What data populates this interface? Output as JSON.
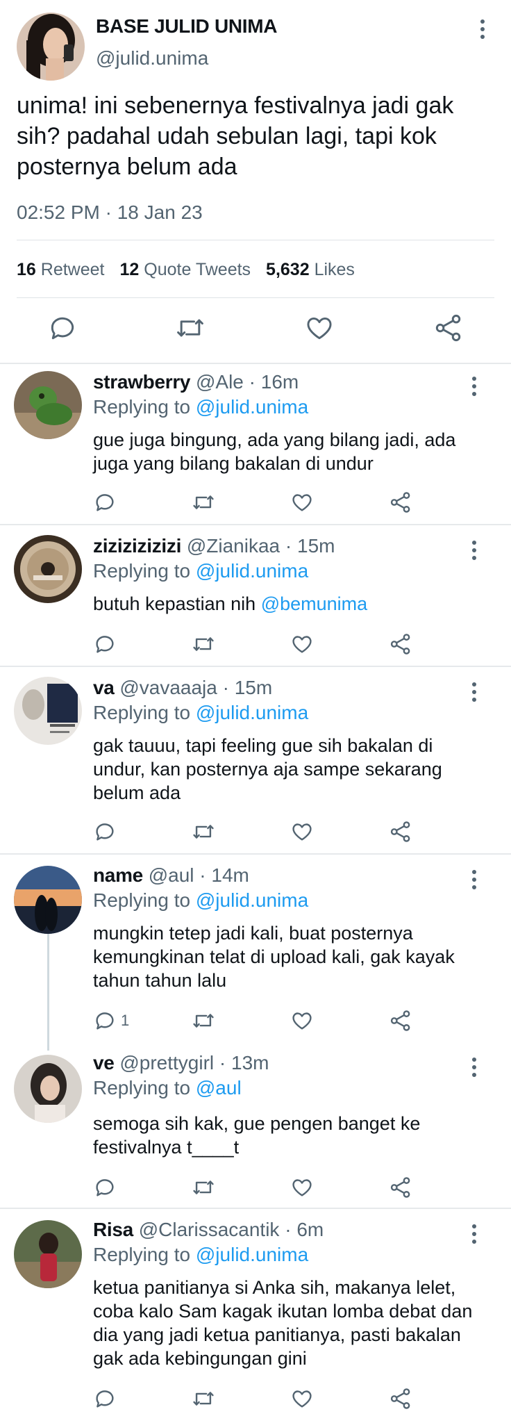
{
  "tweet": {
    "display_name": "BASE JULID UNIMA",
    "handle": "@julid.unima",
    "text": "unima! ini sebenernya festivalnya jadi gak sih? padahal udah sebulan lagi, tapi kok posternya belum ada",
    "timestamp": "02:52 PM · 18 Jan 23",
    "stats": {
      "retweets_count": "16",
      "retweets_label": "Retweet",
      "quotes_count": "12",
      "quotes_label": "Quote Tweets",
      "likes_count": "5,632",
      "likes_label": "Likes"
    },
    "actions": [
      "comment-icon",
      "retweet-icon",
      "heart-icon",
      "share-icon"
    ]
  },
  "replies": [
    {
      "name": "strawberry",
      "handle": "@Ale · 16m",
      "replying_label": "Replying to",
      "replying_to": "@julid.unima",
      "text": "gue juga bingung, ada yang bilang jadi, ada juga yang bilang bakalan di undur",
      "reply_count": ""
    },
    {
      "name": "zizizizizizi",
      "handle": "@Zianikaa · 15m",
      "replying_label": "Replying to",
      "replying_to": "@julid.unima",
      "text_before": "butuh kepastian nih ",
      "mention": "@bemunima",
      "reply_count": ""
    },
    {
      "name": "va",
      "handle": "@vavaaaja · 15m",
      "replying_label": "Replying to",
      "replying_to": "@julid.unima",
      "text": "gak tauuu, tapi feeling gue sih bakalan di undur, kan posternya aja sampe sekarang belum ada",
      "reply_count": ""
    },
    {
      "name": "name",
      "handle": "@aul · 14m",
      "replying_label": "Replying to",
      "replying_to": "@julid.unima",
      "text": "mungkin tetep jadi kali, buat posternya kemungkinan telat di upload kali, gak kayak tahun tahun lalu",
      "reply_count": "1"
    },
    {
      "name": "ve",
      "handle": "@prettygirl · 13m",
      "replying_label": "Replying to",
      "replying_to": "@aul",
      "text": "semoga sih kak, gue pengen banget ke festivalnya t____t",
      "reply_count": ""
    },
    {
      "name": "Risa",
      "handle": "@Clarissacantik · 6m",
      "replying_label": "Replying to",
      "replying_to": "@julid.unima",
      "text": "ketua panitianya si Anka sih, makanya lelet, coba kalo Sam kagak ikutan lomba debat dan dia yang jadi ketua panitianya, pasti bakalan gak ada kebingungan gini",
      "reply_count": ""
    }
  ],
  "colors": {
    "link": "#1d9bf0",
    "muted": "#536471",
    "text": "#0f1419",
    "divider": "#e6e9eb"
  }
}
